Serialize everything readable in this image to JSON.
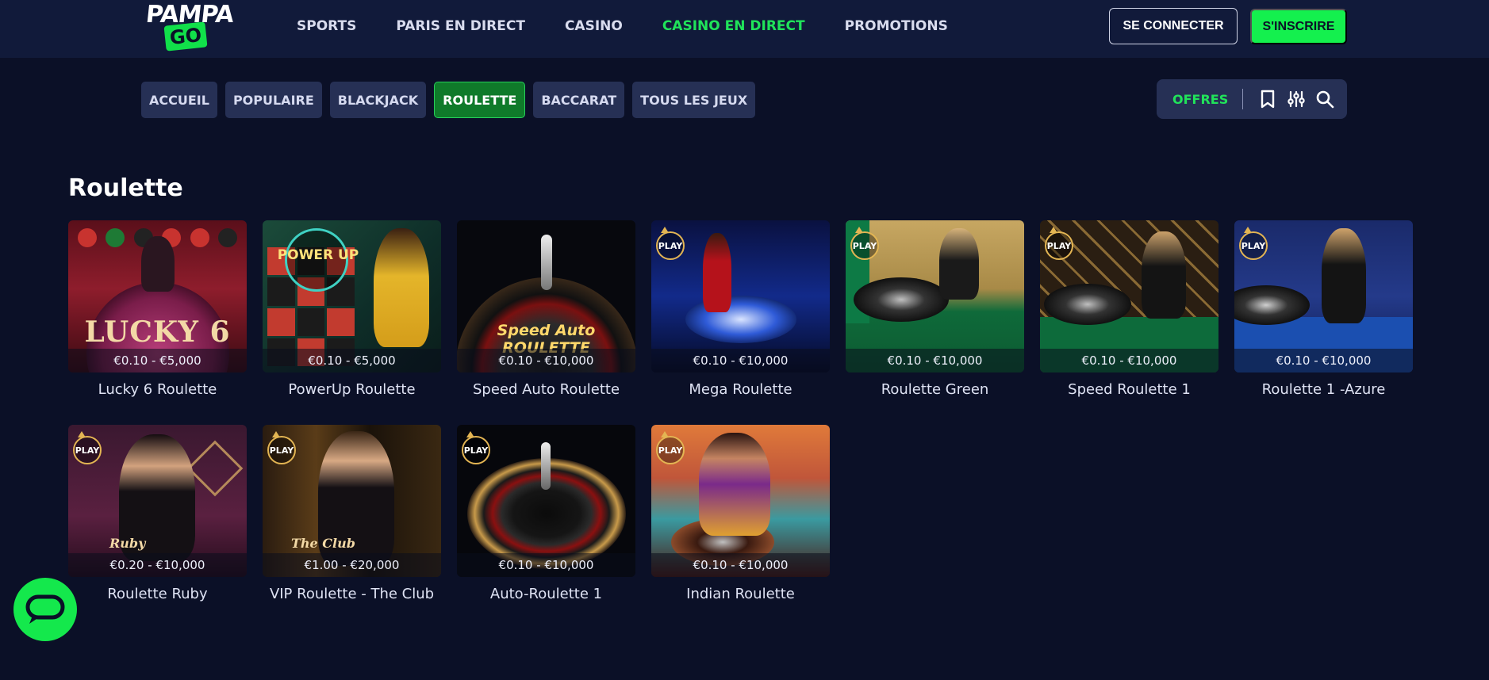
{
  "brand": {
    "logo_top": "PAMPA",
    "logo_bottom": "GO",
    "accent": "#14f04e",
    "background": "#0b1027"
  },
  "nav": {
    "items": [
      {
        "label": "SPORTS",
        "active": false
      },
      {
        "label": "PARIS EN DIRECT",
        "active": false
      },
      {
        "label": "CASINO",
        "active": false
      },
      {
        "label": "CASINO EN DIRECT",
        "active": true
      },
      {
        "label": "PROMOTIONS",
        "active": false
      }
    ],
    "login_label": "SE CONNECTER",
    "signup_label": "S'INSCRIRE"
  },
  "categories": [
    {
      "label": "ACCUEIL",
      "active": false
    },
    {
      "label": "POPULAIRE",
      "active": false
    },
    {
      "label": "BLACKJACK",
      "active": false
    },
    {
      "label": "ROULETTE",
      "active": true
    },
    {
      "label": "BACCARAT",
      "active": false
    },
    {
      "label": "TOUS LES JEUX",
      "active": false
    }
  ],
  "tools": {
    "offers_label": "OFFRES",
    "icons": [
      "bookmark-icon",
      "filter-sliders-icon",
      "search-icon"
    ]
  },
  "section": {
    "title": "Roulette"
  },
  "games": [
    {
      "name": "Lucky 6 Roulette",
      "bets": "€0.10 - €5,000",
      "play_badge": false,
      "art_text": "LUCKY 6"
    },
    {
      "name": "PowerUp Roulette",
      "bets": "€0.10 - €5,000",
      "play_badge": false,
      "art_text": "POWER UP"
    },
    {
      "name": "Speed Auto Roulette",
      "bets": "€0.10 - €10,000",
      "play_badge": false,
      "art_text": "Speed Auto ROULETTE"
    },
    {
      "name": "Mega Roulette",
      "bets": "€0.10 - €10,000",
      "play_badge": true,
      "art_text": ""
    },
    {
      "name": "Roulette Green",
      "bets": "€0.10 - €10,000",
      "play_badge": true,
      "art_text": ""
    },
    {
      "name": "Speed Roulette 1",
      "bets": "€0.10 - €10,000",
      "play_badge": true,
      "art_text": ""
    },
    {
      "name": "Roulette 1 -Azure",
      "bets": "€0.10 - €10,000",
      "play_badge": true,
      "art_text": ""
    },
    {
      "name": "Roulette Ruby",
      "bets": "€0.20 - €10,000",
      "play_badge": true,
      "art_text": "Ruby"
    },
    {
      "name": "VIP Roulette - The Club",
      "bets": "€1.00 - €20,000",
      "play_badge": true,
      "art_text": "The Club"
    },
    {
      "name": "Auto-Roulette 1",
      "bets": "€0.10 - €10,000",
      "play_badge": true,
      "art_text": ""
    },
    {
      "name": "Indian Roulette",
      "bets": "€0.10 - €10,000",
      "play_badge": true,
      "art_text": ""
    }
  ],
  "play_badge_label": "PLAY",
  "chat": {
    "icon": "chat-bubble-icon"
  }
}
